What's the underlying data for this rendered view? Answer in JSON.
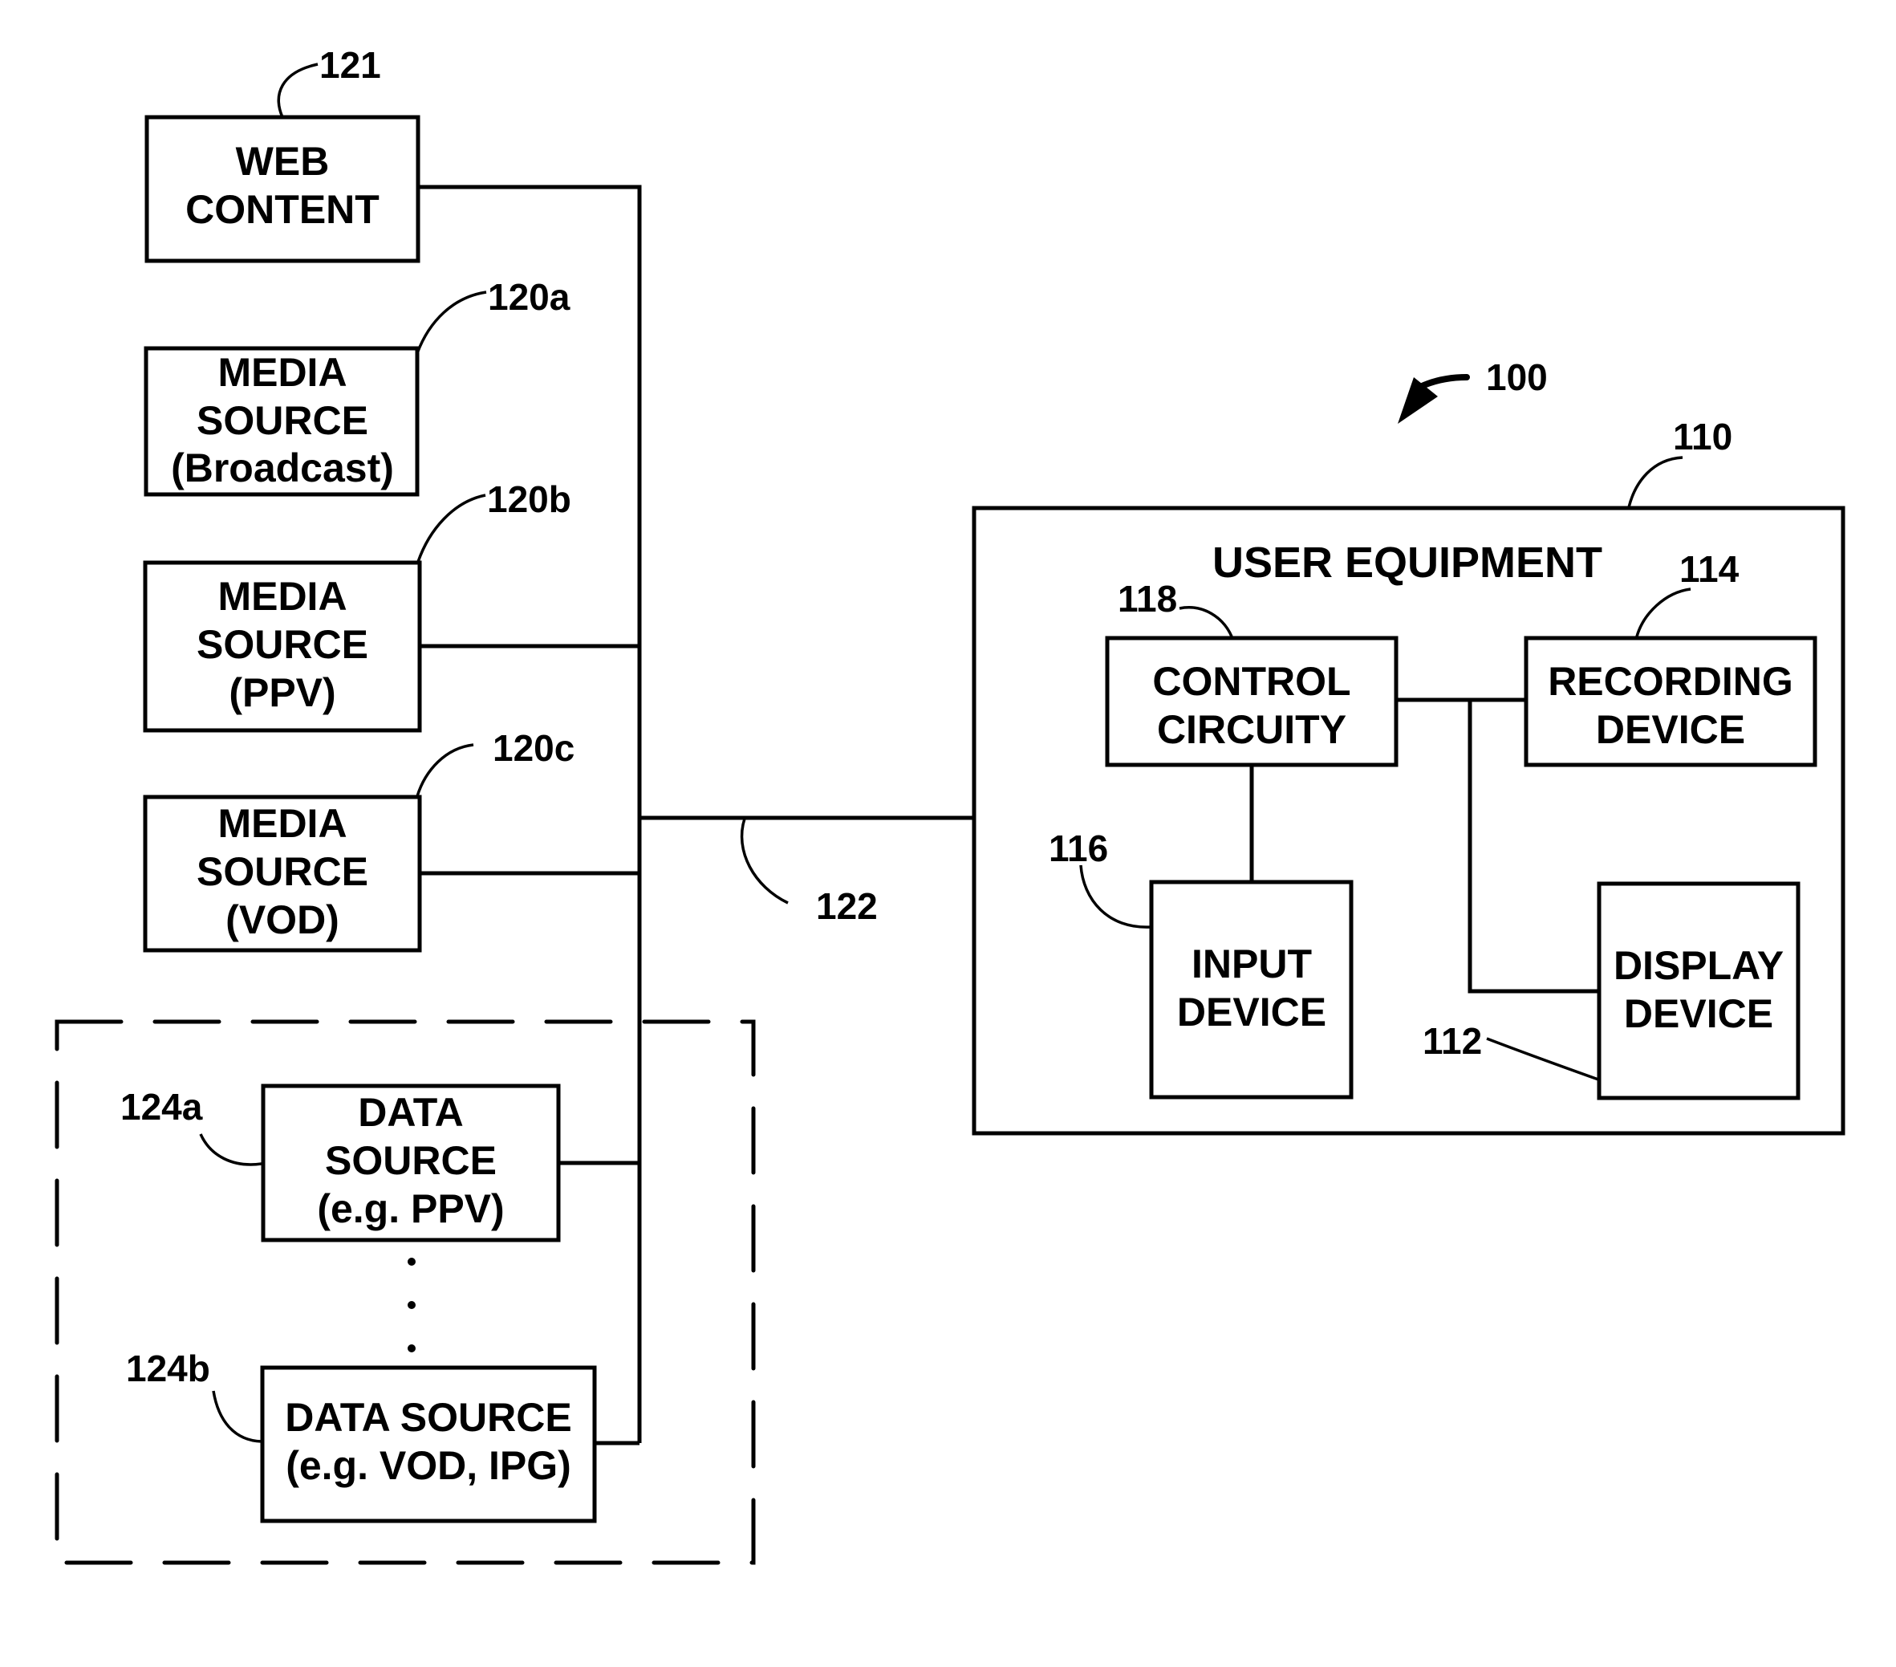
{
  "figure": {
    "system_ref": "100",
    "network_ref": "122",
    "sources": {
      "web_content": {
        "ref": "121",
        "lines": [
          "WEB",
          "CONTENT"
        ]
      },
      "media_broadcast": {
        "ref": "120a",
        "lines": [
          "MEDIA",
          "SOURCE",
          "(Broadcast)"
        ]
      },
      "media_ppv": {
        "ref": "120b",
        "lines": [
          "MEDIA",
          "SOURCE",
          "(PPV)"
        ]
      },
      "media_vod": {
        "ref": "120c",
        "lines": [
          "MEDIA",
          "SOURCE",
          "(VOD)"
        ]
      },
      "data_source_a": {
        "ref": "124a",
        "lines": [
          "DATA",
          "SOURCE",
          "(e.g. PPV)"
        ]
      },
      "data_source_b": {
        "ref": "124b",
        "lines": [
          "DATA SOURCE",
          "(e.g. VOD, IPG)"
        ]
      },
      "ellipsis": [
        "·",
        "·",
        "·"
      ]
    },
    "user_equipment": {
      "ref": "110",
      "title": "USER EQUIPMENT",
      "control_circuitry": {
        "ref": "118",
        "lines": [
          "CONTROL",
          "CIRCUITY"
        ]
      },
      "recording_device": {
        "ref": "114",
        "lines": [
          "RECORDING",
          "DEVICE"
        ]
      },
      "input_device": {
        "ref": "116",
        "lines": [
          "INPUT",
          "DEVICE"
        ]
      },
      "display_device": {
        "ref": "112",
        "lines": [
          "DISPLAY",
          "DEVICE"
        ]
      }
    }
  }
}
